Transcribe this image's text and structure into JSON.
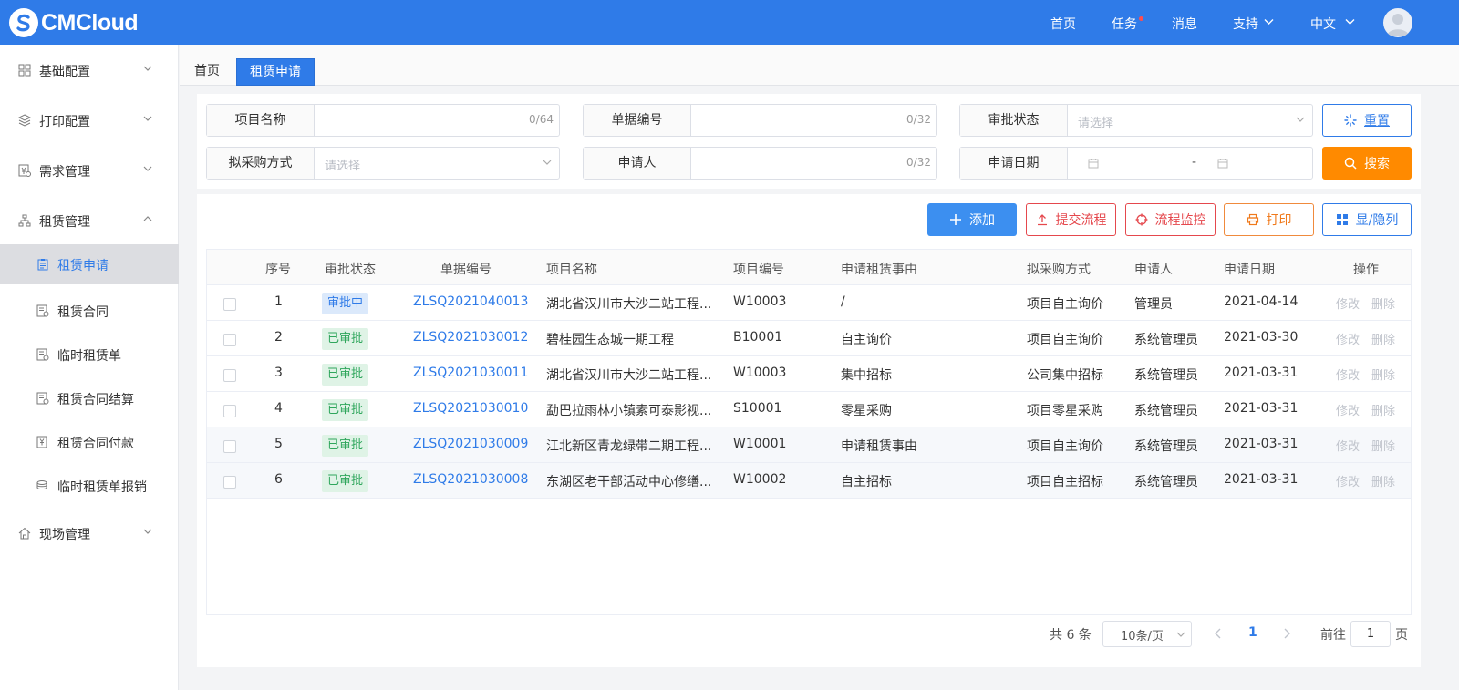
{
  "header": {
    "logo_text": "CMCloud",
    "nav": [
      {
        "label": "首页"
      },
      {
        "label": "任务"
      },
      {
        "label": "消息"
      },
      {
        "label": "支持"
      },
      {
        "label": "中文"
      }
    ]
  },
  "sidebar": {
    "groups": [
      {
        "label": "基础配置",
        "icon": "grid-icon"
      },
      {
        "label": "打印配置",
        "icon": "layers-icon"
      },
      {
        "label": "需求管理",
        "icon": "yen-doc-icon"
      },
      {
        "label": "租赁管理",
        "icon": "org-icon"
      },
      {
        "label": "现场管理",
        "icon": "home-icon"
      }
    ],
    "rental_items": [
      {
        "label": "租赁申请"
      },
      {
        "label": "租赁合同"
      },
      {
        "label": "临时租赁单"
      },
      {
        "label": "租赁合同结算"
      },
      {
        "label": "租赁合同付款"
      },
      {
        "label": "临时租赁单报销"
      }
    ]
  },
  "tabs": {
    "home": "首页",
    "active": "租赁申请"
  },
  "filters": {
    "project_name": {
      "label": "项目名称",
      "count": "0/64"
    },
    "doc_no": {
      "label": "单据编号",
      "count": "0/32"
    },
    "approval_status": {
      "label": "审批状态",
      "placeholder": "请选择"
    },
    "purchase_method": {
      "label": "拟采购方式",
      "placeholder": "请选择"
    },
    "applicant": {
      "label": "申请人",
      "count": "0/32"
    },
    "apply_date": {
      "label": "申请日期",
      "separator": "-"
    },
    "reset_label": "重置",
    "search_label": "搜索"
  },
  "toolbar": {
    "add": "添加",
    "submit_flow": "提交流程",
    "flow_monitor": "流程监控",
    "print": "打印",
    "columns": "显/隐列"
  },
  "table": {
    "headers": {
      "seq": "序号",
      "status": "审批状态",
      "doc_no": "单据编号",
      "project_name": "项目名称",
      "project_no": "项目编号",
      "reason": "申请租赁事由",
      "method": "拟采购方式",
      "applicant": "申请人",
      "date": "申请日期",
      "ops": "操作"
    },
    "edit_label": "修改",
    "delete_label": "删除",
    "rows": [
      {
        "seq": "1",
        "status": "审批中",
        "doc_no": "ZLSQ2021040013",
        "project_name": "湖北省汉川市大沙二站工程...",
        "project_no": "W10003",
        "reason": "/",
        "method": "项目自主询价",
        "applicant": "管理员",
        "date": "2021-04-14"
      },
      {
        "seq": "2",
        "status": "已审批",
        "doc_no": "ZLSQ2021030012",
        "project_name": "碧桂园生态城一期工程",
        "project_no": "B10001",
        "reason": "自主询价",
        "method": "项目自主询价",
        "applicant": "系统管理员",
        "date": "2021-03-30"
      },
      {
        "seq": "3",
        "status": "已审批",
        "doc_no": "ZLSQ2021030011",
        "project_name": "湖北省汉川市大沙二站工程...",
        "project_no": "W10003",
        "reason": "集中招标",
        "method": "公司集中招标",
        "applicant": "系统管理员",
        "date": "2021-03-31"
      },
      {
        "seq": "4",
        "status": "已审批",
        "doc_no": "ZLSQ2021030010",
        "project_name": "勐巴拉雨林小镇素可泰影视...",
        "project_no": "S10001",
        "reason": "零星采购",
        "method": "项目零星采购",
        "applicant": "系统管理员",
        "date": "2021-03-31"
      },
      {
        "seq": "5",
        "status": "已审批",
        "doc_no": "ZLSQ2021030009",
        "project_name": "江北新区青龙绿带二期工程...",
        "project_no": "W10001",
        "reason": "申请租赁事由",
        "method": "项目自主询价",
        "applicant": "系统管理员",
        "date": "2021-03-31"
      },
      {
        "seq": "6",
        "status": "已审批",
        "doc_no": "ZLSQ2021030008",
        "project_name": "东湖区老干部活动中心修缮...",
        "project_no": "W10002",
        "reason": "自主招标",
        "method": "项目自主招标",
        "applicant": "系统管理员",
        "date": "2021-03-31"
      }
    ]
  },
  "pagination": {
    "total": "共 6 条",
    "page_size": "10条/页",
    "current_page": "1",
    "goto_prefix": "前往",
    "goto_value": "1",
    "goto_suffix": "页"
  },
  "colors": {
    "primary": "#2f7be8",
    "orange": "#ff8a00",
    "danger": "#e5484d"
  }
}
